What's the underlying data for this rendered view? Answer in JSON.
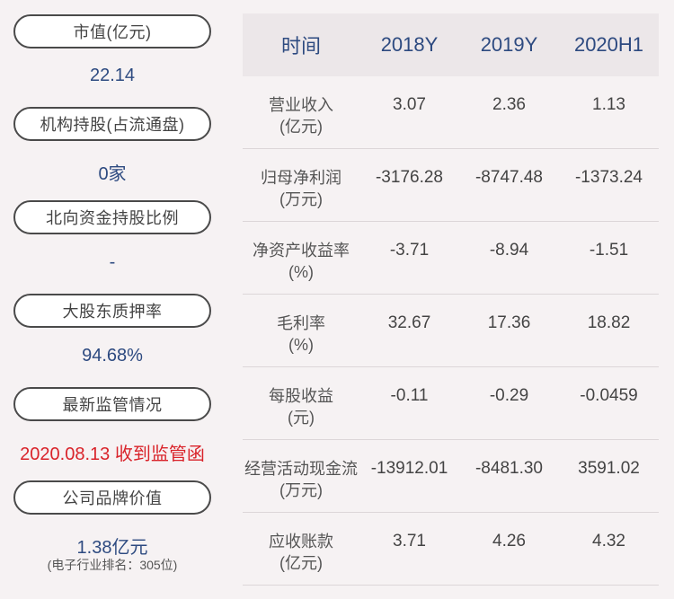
{
  "left": {
    "items": [
      {
        "label": "市值(亿元)",
        "value": "22.14"
      },
      {
        "label": "机构持股(占流通盘)",
        "value": "0家"
      },
      {
        "label": "北向资金持股比例",
        "value": "-"
      },
      {
        "label": "大股东质押率",
        "value": "94.68%"
      },
      {
        "label": "最新监管情况",
        "value": "2020.08.13 收到监管函"
      },
      {
        "label": "公司品牌价值",
        "value": "1.38亿元",
        "note": "(电子行业排名：305位)"
      }
    ]
  },
  "table": {
    "headers": [
      "时间",
      "2018Y",
      "2019Y",
      "2020H1"
    ],
    "rows": [
      {
        "label_line1": "营业收入",
        "label_line2": "(亿元)",
        "values": [
          "3.07",
          "2.36",
          "1.13"
        ]
      },
      {
        "label_line1": "归母净利润",
        "label_line2": "(万元)",
        "values": [
          "-3176.28",
          "-8747.48",
          "-1373.24"
        ]
      },
      {
        "label_line1": "净资产收益率",
        "label_line2": "(%)",
        "values": [
          "-3.71",
          "-8.94",
          "-1.51"
        ]
      },
      {
        "label_line1": "毛利率",
        "label_line2": "(%)",
        "values": [
          "32.67",
          "17.36",
          "18.82"
        ]
      },
      {
        "label_line1": "每股收益",
        "label_line2": "(元)",
        "values": [
          "-0.11",
          "-0.29",
          "-0.0459"
        ]
      },
      {
        "label_line1": "经营活动现金流",
        "label_line2": "(万元)",
        "values": [
          "-13912.01",
          "-8481.30",
          "3591.02"
        ]
      },
      {
        "label_line1": "应收账款",
        "label_line2": "(亿元)",
        "values": [
          "3.71",
          "4.26",
          "4.32"
        ]
      }
    ]
  },
  "colors": {
    "background": "#f6f2f3",
    "header_bg": "#ece7e9",
    "value_blue": "#2d4a80",
    "alert_red": "#d9232a"
  }
}
